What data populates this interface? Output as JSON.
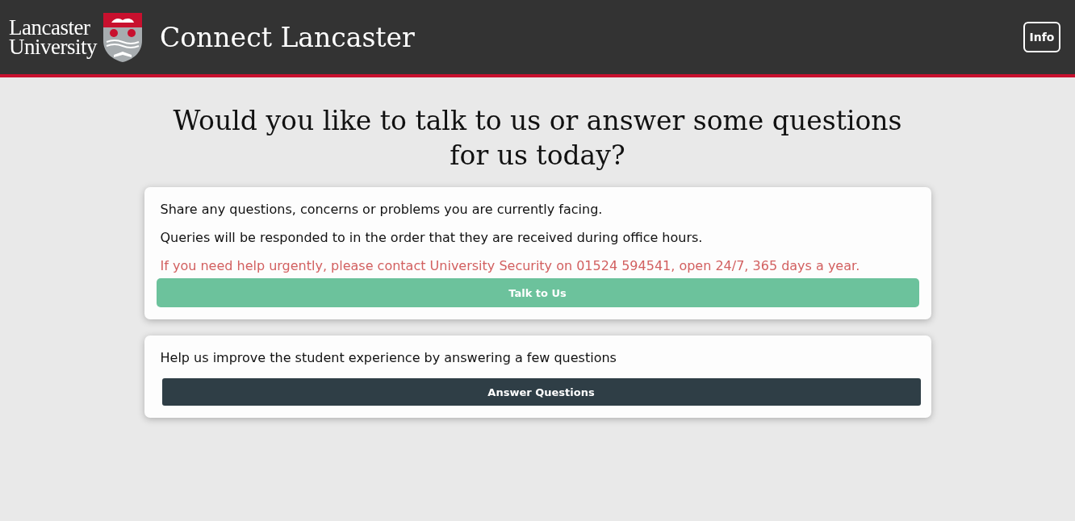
{
  "header": {
    "logo": [
      "Lancaster",
      "University"
    ],
    "title": "Connect Lancaster",
    "info_button": "Info"
  },
  "heading": "Would you like to talk to us or answer some questions for us today?",
  "cards": [
    {
      "paragraphs": [
        {
          "text": "Share any questions, concerns or problems you are currently facing.",
          "kind": "normal"
        },
        {
          "text": "Queries will be responded to in the order that they are received during office hours.",
          "kind": "normal"
        },
        {
          "text": "If you need help urgently, please contact University Security on 01524 594541, open 24/7, 365 days a year.",
          "kind": "warning"
        }
      ],
      "button": {
        "label": "Talk to Us",
        "kind": "primary"
      }
    },
    {
      "paragraphs": [
        {
          "text": "Help us improve the student experience by answering a few questions",
          "kind": "normal"
        }
      ],
      "button": {
        "label": "Answer Questions",
        "kind": "dark"
      }
    }
  ]
}
